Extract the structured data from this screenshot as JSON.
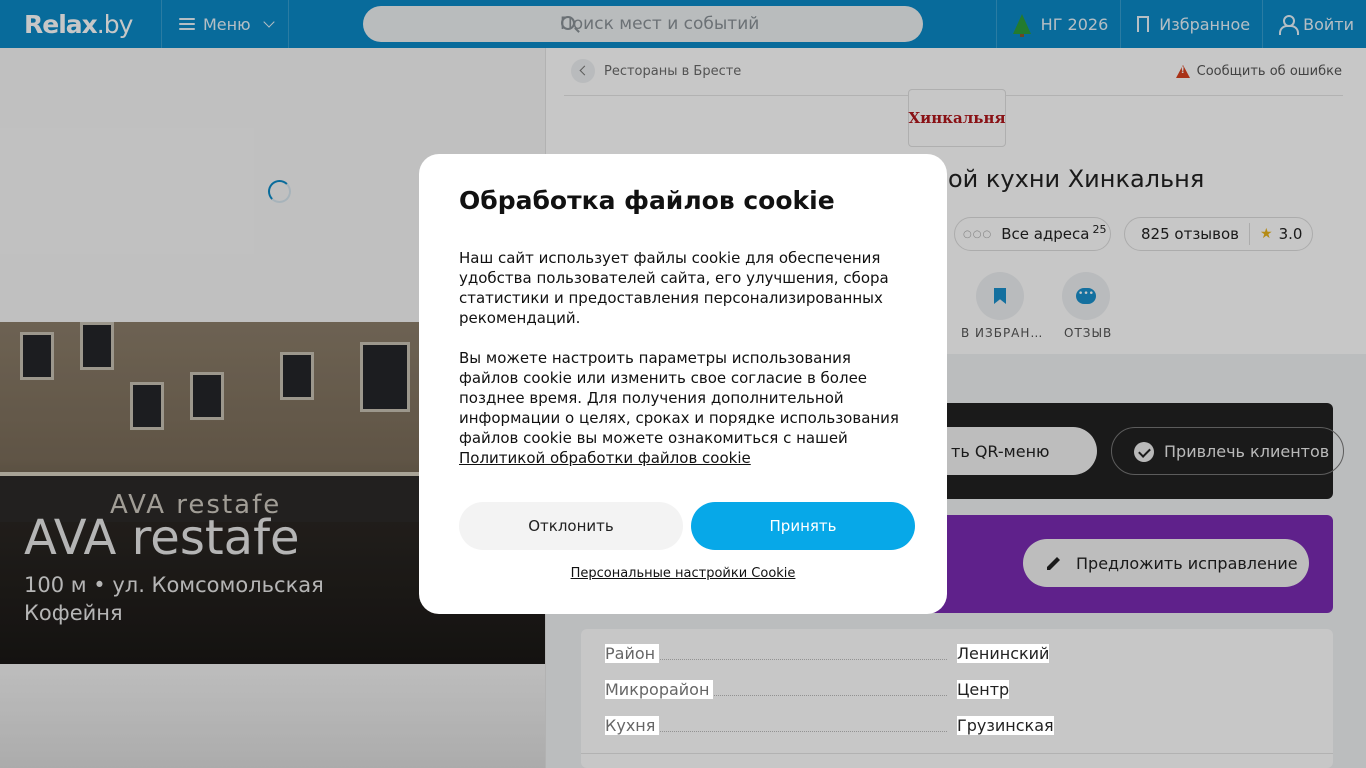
{
  "header": {
    "logo_main": "Relax",
    "logo_suffix": ".by",
    "menu_label": "Меню",
    "search_placeholder": "Поиск мест и событий",
    "ny_label": "НГ 2026",
    "favorites_label": "Избранное",
    "login_label": "Войти"
  },
  "left": {
    "place_title": "AVA restafe",
    "place_location": "100 м • ул. Комсомольская",
    "place_category": "Кофейня",
    "sign_text": "AVA restafe"
  },
  "right": {
    "breadcrumb": "Рестораны в Бресте",
    "report_label": "Сообщить об ошибке",
    "logo_text": "Хинкальня",
    "title_visible": "ой кухни Хинкальня",
    "addresses_label": "Все адреса",
    "addresses_count": "25",
    "reviews_label": "825 отзывов",
    "rating": "3.0",
    "actions": [
      {
        "label": "В ИЗБРАН…"
      },
      {
        "label": "ОТЗЫВ"
      }
    ],
    "qr_label": "ть QR-меню",
    "attract_label": "Привлечь клиентов",
    "suggest_label": "Предложить исправление",
    "info": [
      {
        "key": "Район",
        "value": "Ленинский"
      },
      {
        "key": "Микрорайон",
        "value": "Центр"
      },
      {
        "key": "Кухня",
        "value": "Грузинская"
      }
    ]
  },
  "cookie_modal": {
    "title": "Обработка файлов cookie",
    "paragraph1": "Наш сайт использует файлы cookie для обеспечения удобства пользователей сайта, его улучшения, сбора статистики и предоставления персонализированных рекомендаций.",
    "paragraph2": "Вы можете настроить параметры использования файлов cookie или изменить свое согласие в более позднее время. Для получения дополнительной информации о целях, сроках и порядке использования файлов cookie вы можете ознакомиться с нашей",
    "policy_link": "Политикой обработки файлов cookie",
    "decline_label": "Отклонить",
    "accept_label": "Принять",
    "settings_link": "Персональные настройки Cookie"
  },
  "colors": {
    "header_bg": "#0b8ac7",
    "accept_bg": "#07a8e8",
    "purple_banner": "#7a2bb3",
    "dark_banner": "#222222"
  }
}
